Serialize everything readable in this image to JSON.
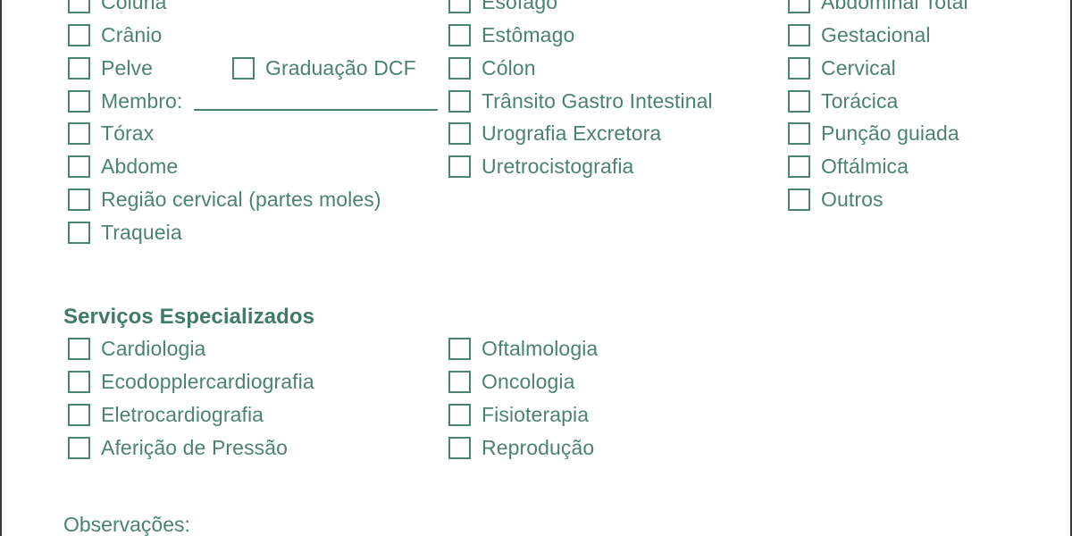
{
  "page": {
    "accent_color": "#4b8272",
    "heading_color": "#417a65",
    "border_color": "#3a3a3a",
    "background": "#ffffff"
  },
  "exams": {
    "column_radiology": [
      {
        "label": "Coluna"
      },
      {
        "label": "Crânio"
      },
      {
        "label": "Pelve"
      },
      {
        "label": "Membro:"
      },
      {
        "label": "Tórax"
      },
      {
        "label": "Abdome"
      },
      {
        "label": "Região cervical (partes moles)"
      },
      {
        "label": "Traqueia"
      }
    ],
    "graduacao": {
      "label": "Graduação DCF"
    },
    "column_contrast": [
      {
        "label": "Esôfago"
      },
      {
        "label": "Estômago"
      },
      {
        "label": "Cólon"
      },
      {
        "label": "Trânsito Gastro Intestinal"
      },
      {
        "label": "Urografia Excretora"
      },
      {
        "label": "Uretrocistografia"
      }
    ],
    "column_ultrasound": [
      {
        "label": "Abdominal Total"
      },
      {
        "label": "Gestacional"
      },
      {
        "label": "Cervical"
      },
      {
        "label": "Torácica"
      },
      {
        "label": "Punção guiada"
      },
      {
        "label": "Oftálmica"
      },
      {
        "label": "Outros"
      }
    ]
  },
  "specialized": {
    "title": "Serviços Especializados",
    "column_left": [
      {
        "label": "Cardiologia"
      },
      {
        "label": "Ecodopplercardiografia"
      },
      {
        "label": "Eletrocardiografia"
      },
      {
        "label": "Aferição de Pressão"
      }
    ],
    "column_right": [
      {
        "label": "Oftalmologia"
      },
      {
        "label": "Oncologia"
      },
      {
        "label": "Fisioterapia"
      },
      {
        "label": "Reprodução"
      }
    ]
  },
  "observations": {
    "label": "Observações:"
  }
}
